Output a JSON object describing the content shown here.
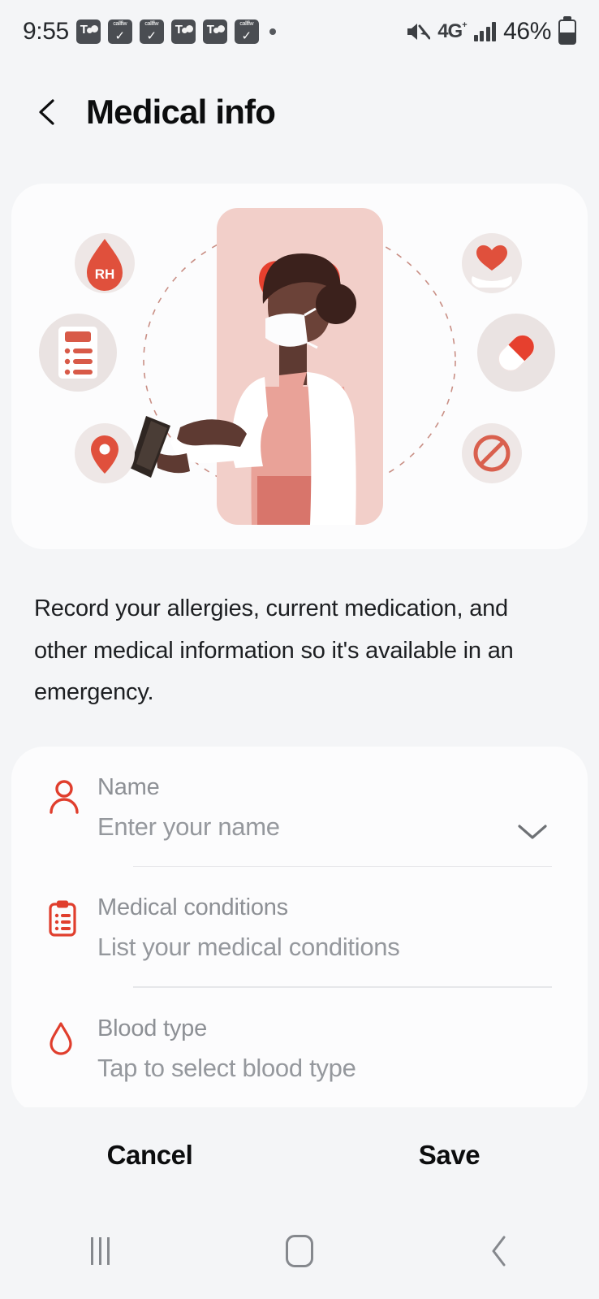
{
  "status_bar": {
    "time": "9:55",
    "app_icons": [
      {
        "name": "teams-icon",
        "type": "teams"
      },
      {
        "name": "callflow-icon",
        "type": "flow",
        "label": "callflw",
        "glyph": "✓"
      },
      {
        "name": "callflow-icon",
        "type": "flow",
        "label": "callflw",
        "glyph": "✓"
      },
      {
        "name": "teams-icon",
        "type": "teams"
      },
      {
        "name": "teams-icon",
        "type": "teams"
      },
      {
        "name": "callflow-icon",
        "type": "flow",
        "label": "callflw",
        "glyph": "✓"
      }
    ],
    "more_notifications_dot": "•",
    "mute_icon": "sound-muted-icon",
    "network_type": "4G",
    "network_suffix": "+",
    "signal_bars": 4,
    "battery_percent": "46%",
    "battery_level": 46
  },
  "header": {
    "back_label": "back-chevron",
    "title": "Medical info"
  },
  "illustration": {
    "name": "medical-info-illustration",
    "alt": "Doctor wearing a mask holding a tablet surrounded by medical icons",
    "icons": [
      {
        "name": "blood-type-rh-icon",
        "label": "RH"
      },
      {
        "name": "heart-pulse-icon",
        "label": ""
      },
      {
        "name": "heart-in-hand-icon",
        "label": ""
      },
      {
        "name": "clipboard-checklist-icon",
        "label": ""
      },
      {
        "name": "pill-capsule-icon",
        "label": ""
      },
      {
        "name": "location-pin-icon",
        "label": ""
      },
      {
        "name": "prohibition-sign-icon",
        "label": ""
      }
    ]
  },
  "description": "Record your allergies, current medication, and other medical information so it's available in an emergency.",
  "form": {
    "fields": [
      {
        "icon": "person-icon",
        "label": "Name",
        "value": "Enter your name",
        "has_dropdown": true
      },
      {
        "icon": "clipboard-icon",
        "label": "Medical conditions",
        "value": "List your medical conditions",
        "has_dropdown": false
      },
      {
        "icon": "blood-drop-icon",
        "label": "Blood type",
        "value": "Tap to select blood type",
        "has_dropdown": false
      }
    ]
  },
  "actions": {
    "cancel_label": "Cancel",
    "save_label": "Save"
  },
  "navigation_bar": {
    "recents_label": "recents-button",
    "home_label": "home-button",
    "back_label": "back-button"
  },
  "colors": {
    "accent_red": "#e03e2d",
    "background": "#f4f5f7",
    "card": "#fcfcfd",
    "illustration_panel": "#f2cfc9",
    "label_gray": "#8d9095"
  }
}
